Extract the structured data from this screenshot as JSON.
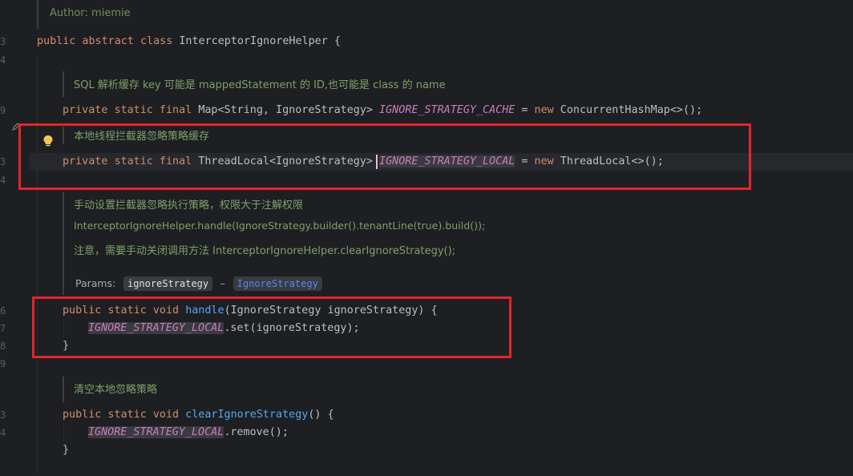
{
  "editor": {
    "gutter_line_numbers": [
      "3",
      "4",
      "9",
      "3",
      "4",
      "6",
      "7",
      "8",
      "9",
      "3",
      "4"
    ],
    "class_doc": {
      "author": "Author: miemie"
    },
    "class_decl": {
      "kw": "public abstract class",
      "name": "InterceptorIgnoreHelper",
      "brace": "{"
    },
    "cache_doc": "SQL 解析缓存 key 可能是 mappedStatement 的 ID,也可能是 class 的 name",
    "cache_field": {
      "kw1": "private static final",
      "type": "Map<String, IgnoreStrategy>",
      "const": "IGNORE_STRATEGY_CACHE",
      "eq": "=",
      "kw2": "new",
      "init": "ConcurrentHashMap<>();"
    },
    "local_doc": "本地线程拦截器忽略策略缓存",
    "local_field": {
      "kw1": "private static final",
      "type": "ThreadLocal<IgnoreStrategy>",
      "const": "IGNORE_STRATEGY_LOCAL",
      "eq": "=",
      "kw2": "new",
      "init": "ThreadLocal<>();"
    },
    "handle_doc": {
      "line1": "手动设置拦截器忽略执行策略，权限大于注解权限",
      "line2": "InterceptorIgnoreHelper.handle(IgnoreStrategy.builder().tenantLine(true).build());",
      "line3": "注意，需要手动关闭调用方法 InterceptorIgnoreHelper.clearIgnoreStrategy();",
      "params_label": "Params:",
      "param_name": "ignoreStrategy",
      "param_sep": "–",
      "param_type": "IgnoreStrategy"
    },
    "handle_method": {
      "kw": "public static void",
      "name": "handle",
      "sig": "(IgnoreStrategy ignoreStrategy) {",
      "body_const": "IGNORE_STRATEGY_LOCAL",
      "body_rest": ".set(ignoreStrategy);",
      "close": "}"
    },
    "clear_doc": "清空本地忽略策略",
    "clear_method": {
      "kw": "public static void",
      "name": "clearIgnoreStrategy",
      "sig": "() {",
      "body_const": "IGNORE_STRATEGY_LOCAL",
      "body_rest": ".remove();",
      "close": "}"
    }
  },
  "colors": {
    "background": "#1e1f22",
    "keyword": "#cf8e6d",
    "function": "#56a8f5",
    "constant": "#c77dbb",
    "doc_comment": "#7ea06a",
    "highlight_box": "#e3262b"
  },
  "icons": {
    "intention_bulb": "lightbulb-icon",
    "edit_marker": "pencil-icon"
  }
}
